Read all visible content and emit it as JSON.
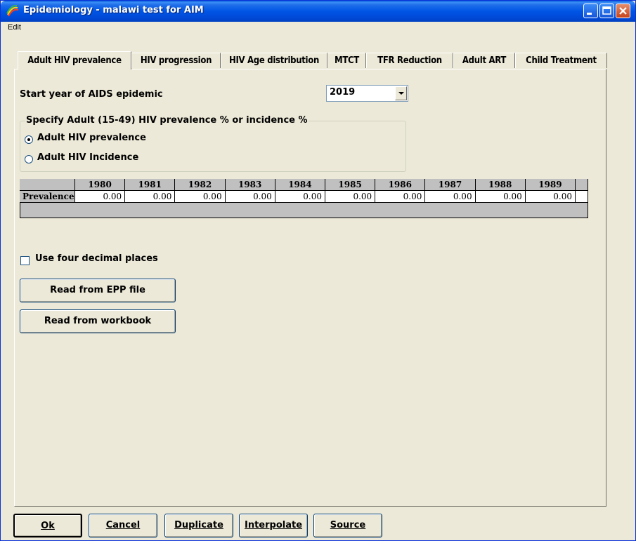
{
  "window": {
    "title": "Epidemiology - malawi test for AIM"
  },
  "menu": {
    "edit": "Edit"
  },
  "tabs": [
    {
      "label": "Adult HIV prevalence",
      "active": true
    },
    {
      "label": "HIV progression",
      "active": false
    },
    {
      "label": "HIV Age distribution",
      "active": false
    },
    {
      "label": "MTCT",
      "active": false
    },
    {
      "label": "TFR Reduction",
      "active": false
    },
    {
      "label": "Adult ART",
      "active": false
    },
    {
      "label": "Child Treatment",
      "active": false
    }
  ],
  "start_year": {
    "label": "Start year of AIDS epidemic",
    "value": "2019"
  },
  "specify": {
    "title": "Specify Adult (15-49) HIV prevalence % or incidence %",
    "options": [
      {
        "label": "Adult HIV prevalence",
        "selected": true
      },
      {
        "label": "Adult HIV Incidence",
        "selected": false
      }
    ]
  },
  "grid": {
    "row_label": "Prevalence",
    "years": [
      "1980",
      "1981",
      "1982",
      "1983",
      "1984",
      "1985",
      "1986",
      "1987",
      "1988",
      "1989"
    ],
    "values": [
      "0.00",
      "0.00",
      "0.00",
      "0.00",
      "0.00",
      "0.00",
      "0.00",
      "0.00",
      "0.00",
      "0.00"
    ]
  },
  "four_decimals": {
    "label": "Use four decimal places",
    "checked": false
  },
  "buttons": {
    "read_epp": "Read from EPP file",
    "read_workbook": "Read from workbook"
  },
  "footer": {
    "ok": "Ok",
    "cancel": "Cancel",
    "duplicate": "Duplicate",
    "interpolate": "Interpolate",
    "source": "Source"
  }
}
